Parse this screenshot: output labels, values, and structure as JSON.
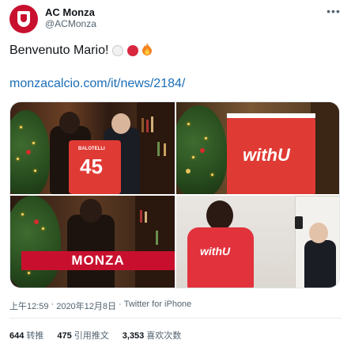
{
  "account": {
    "display_name": "AC Monza",
    "handle": "@ACMonza"
  },
  "tweet": {
    "text": "Benvenuto Mario!",
    "emojis": [
      "white-circle",
      "red-circle",
      "fire"
    ],
    "link": "monzacalcio.com/it/news/2184/"
  },
  "media": {
    "photos": [
      {
        "jersey_number": "45",
        "jersey_name": "BALOTELLI"
      },
      {
        "jersey_text": "withU"
      },
      {
        "scarf_text": "MONZA"
      },
      {
        "jersey_text": "withU"
      }
    ]
  },
  "meta": {
    "time": "上午12:59",
    "date": "2020年12月8日",
    "separator": "·",
    "source": "Twitter for iPhone"
  },
  "stats": [
    {
      "count": "644",
      "label": "转推"
    },
    {
      "count": "475",
      "label": "引用推文"
    },
    {
      "count": "3,353",
      "label": "喜欢次数"
    }
  ],
  "colors": {
    "brand_red": "#c8102e",
    "link": "#1b6db6",
    "text_secondary": "#536471"
  }
}
